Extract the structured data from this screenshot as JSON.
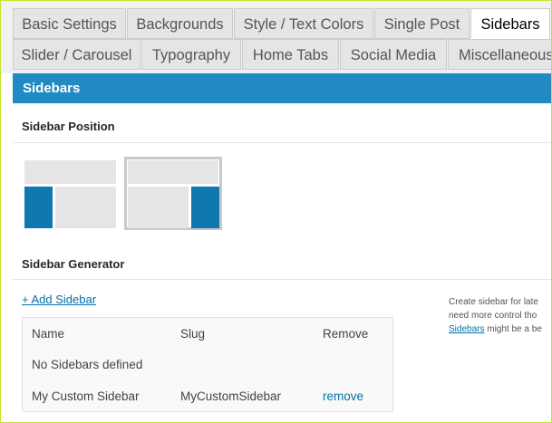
{
  "tabs_row1": [
    "Basic Settings",
    "Backgrounds",
    "Style / Text Colors",
    "Single Post",
    "Sidebars"
  ],
  "tabs_row2": [
    "Slider / Carousel",
    "Typography",
    "Home Tabs",
    "Social Media",
    "Miscellaneous"
  ],
  "active_tab": "Sidebars",
  "header": {
    "title": "Sidebars"
  },
  "position": {
    "title": "Sidebar Position",
    "options": [
      "left-sidebar",
      "right-sidebar"
    ],
    "selected": "right-sidebar"
  },
  "generator": {
    "title": "Sidebar Generator",
    "add_link": "+ Add Sidebar",
    "help_line1": "Create sidebar for late",
    "help_line2": "need more control tho",
    "help_link": "Sidebars",
    "help_line3_rest": " might be a be"
  },
  "table": {
    "headers": [
      "Name",
      "Slug",
      "Remove"
    ],
    "empty_text": "No Sidebars defined",
    "rows": [
      {
        "name": "My Custom Sidebar",
        "slug": "MyCustomSidebar",
        "remove": "remove"
      }
    ]
  },
  "colors": {
    "accent": "#2189c4",
    "sidebar_block": "#0f78b0",
    "frame_border": "#bfe82a"
  }
}
